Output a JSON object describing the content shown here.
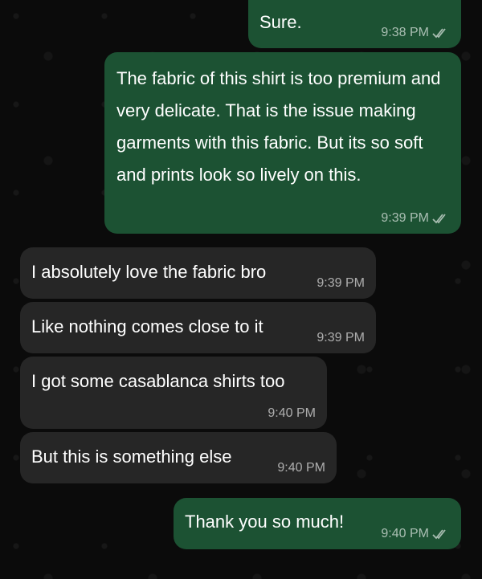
{
  "chat": {
    "messages": [
      {
        "direction": "outgoing",
        "text": "Sure.",
        "time": "9:38 PM",
        "status": "read"
      },
      {
        "direction": "outgoing",
        "text": "The fabric of this shirt is too premium and very delicate. That is the issue making garments with this fabric. But its so soft and prints look so lively on this.",
        "time": "9:39 PM",
        "status": "read"
      },
      {
        "direction": "incoming",
        "text": "I absolutely love the fabric bro",
        "time": "9:39 PM"
      },
      {
        "direction": "incoming",
        "text": "Like nothing comes close to it",
        "time": "9:39 PM"
      },
      {
        "direction": "incoming",
        "text": "I got some casablanca shirts too",
        "time": "9:40 PM"
      },
      {
        "direction": "incoming",
        "text": "But this is something else",
        "time": "9:40 PM"
      },
      {
        "direction": "outgoing",
        "text": "Thank you so much!",
        "time": "9:40 PM",
        "status": "read"
      }
    ]
  },
  "colors": {
    "outgoing_bubble": "#1c5233",
    "incoming_bubble": "#262626",
    "background": "#0b0b0b"
  }
}
